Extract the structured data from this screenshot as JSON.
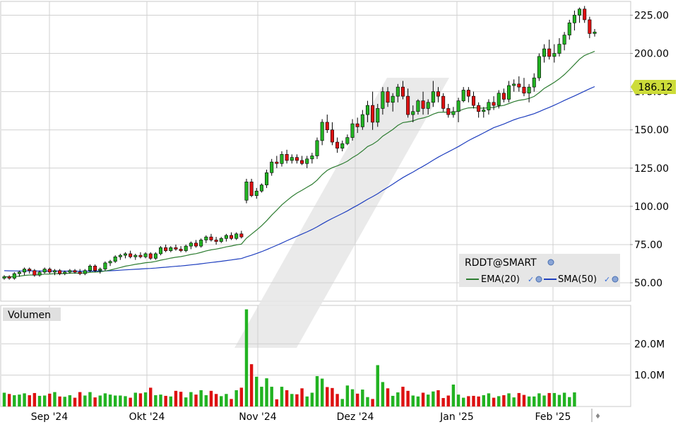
{
  "chart_data": {
    "type": "candlestick",
    "symbol": "RDDT@SMART",
    "last_price": "186.12",
    "price_axis": {
      "ticks": [
        "225.00",
        "200.00",
        "175.00",
        "150.00",
        "125.00",
        "100.00",
        "75.00",
        "50.00"
      ],
      "ylim": [
        38,
        234
      ]
    },
    "volume_axis": {
      "title": "Volumen",
      "ticks": [
        "20.0M",
        "10.0M"
      ],
      "ylim": [
        0,
        30
      ]
    },
    "x_labels": [
      "Sep '24",
      "Okt '24",
      "Nov '24",
      "Dez '24",
      "Jan '25",
      "Feb '25"
    ],
    "legend": [
      {
        "name": "EMA(20)",
        "color": "#2e7d32"
      },
      {
        "name": "SMA(50)",
        "color": "#1f3fbf"
      }
    ],
    "ohlc": [
      [
        53,
        55,
        52,
        54
      ],
      [
        54,
        55,
        52,
        53
      ],
      [
        53,
        57,
        52,
        56
      ],
      [
        56,
        58,
        54,
        57
      ],
      [
        57,
        60,
        55,
        59
      ],
      [
        59,
        60,
        56,
        58
      ],
      [
        58,
        59,
        54,
        55
      ],
      [
        55,
        58,
        54,
        57
      ],
      [
        57,
        60,
        56,
        59
      ],
      [
        59,
        60,
        56,
        57
      ],
      [
        57,
        59,
        55,
        58
      ],
      [
        58,
        59,
        55,
        56
      ],
      [
        56,
        58,
        55,
        57
      ],
      [
        57,
        59,
        56,
        58
      ],
      [
        58,
        59,
        56,
        57
      ],
      [
        57,
        59,
        55,
        56
      ],
      [
        56,
        59,
        55,
        58
      ],
      [
        58,
        62,
        57,
        61
      ],
      [
        61,
        62,
        57,
        58
      ],
      [
        58,
        60,
        56,
        59
      ],
      [
        59,
        64,
        58,
        63
      ],
      [
        63,
        65,
        61,
        64
      ],
      [
        64,
        68,
        63,
        67
      ],
      [
        67,
        69,
        65,
        68
      ],
      [
        68,
        70,
        66,
        69
      ],
      [
        69,
        71,
        66,
        67
      ],
      [
        67,
        69,
        65,
        68
      ],
      [
        68,
        70,
        66,
        67
      ],
      [
        67,
        70,
        66,
        69
      ],
      [
        69,
        70,
        65,
        66
      ],
      [
        66,
        70,
        65,
        69
      ],
      [
        69,
        74,
        68,
        73
      ],
      [
        73,
        75,
        70,
        71
      ],
      [
        71,
        74,
        70,
        73
      ],
      [
        73,
        75,
        71,
        72
      ],
      [
        72,
        74,
        70,
        71
      ],
      [
        71,
        75,
        70,
        74
      ],
      [
        74,
        77,
        72,
        76
      ],
      [
        76,
        78,
        73,
        74
      ],
      [
        74,
        79,
        73,
        78
      ],
      [
        78,
        81,
        76,
        80
      ],
      [
        80,
        82,
        77,
        78
      ],
      [
        78,
        80,
        75,
        77
      ],
      [
        77,
        80,
        76,
        79
      ],
      [
        79,
        82,
        77,
        81
      ],
      [
        81,
        83,
        78,
        79
      ],
      [
        79,
        83,
        78,
        82
      ],
      [
        82,
        84,
        79,
        80
      ],
      [
        104,
        118,
        102,
        116
      ],
      [
        116,
        118,
        106,
        107
      ],
      [
        107,
        112,
        105,
        110
      ],
      [
        110,
        115,
        109,
        114
      ],
      [
        114,
        124,
        112,
        122
      ],
      [
        122,
        131,
        120,
        129
      ],
      [
        129,
        133,
        125,
        128
      ],
      [
        128,
        136,
        126,
        134
      ],
      [
        134,
        137,
        128,
        130
      ],
      [
        130,
        134,
        128,
        132
      ],
      [
        132,
        134,
        128,
        130
      ],
      [
        130,
        133,
        127,
        128
      ],
      [
        128,
        133,
        125,
        131
      ],
      [
        131,
        135,
        128,
        133
      ],
      [
        133,
        145,
        131,
        143
      ],
      [
        143,
        157,
        140,
        155
      ],
      [
        155,
        160,
        148,
        150
      ],
      [
        150,
        155,
        140,
        142
      ],
      [
        142,
        145,
        135,
        138
      ],
      [
        138,
        143,
        136,
        141
      ],
      [
        141,
        147,
        140,
        145
      ],
      [
        145,
        157,
        143,
        154
      ],
      [
        154,
        158,
        148,
        152
      ],
      [
        152,
        163,
        150,
        160
      ],
      [
        160,
        169,
        155,
        166
      ],
      [
        166,
        175,
        150,
        155
      ],
      [
        155,
        167,
        152,
        164
      ],
      [
        164,
        178,
        160,
        175
      ],
      [
        175,
        178,
        165,
        168
      ],
      [
        168,
        174,
        162,
        172
      ],
      [
        172,
        180,
        168,
        178
      ],
      [
        178,
        182,
        170,
        172
      ],
      [
        172,
        177,
        158,
        160
      ],
      [
        160,
        166,
        155,
        162
      ],
      [
        162,
        170,
        160,
        169
      ],
      [
        169,
        175,
        160,
        164
      ],
      [
        164,
        170,
        160,
        168
      ],
      [
        168,
        182,
        165,
        175
      ],
      [
        175,
        178,
        168,
        172
      ],
      [
        172,
        174,
        162,
        164
      ],
      [
        164,
        167,
        158,
        160
      ],
      [
        160,
        165,
        158,
        162
      ],
      [
        162,
        171,
        155,
        169
      ],
      [
        169,
        178,
        168,
        176
      ],
      [
        176,
        178,
        168,
        172
      ],
      [
        172,
        175,
        164,
        166
      ],
      [
        166,
        168,
        158,
        162
      ],
      [
        162,
        165,
        158,
        163
      ],
      [
        163,
        170,
        160,
        168
      ],
      [
        168,
        172,
        163,
        166
      ],
      [
        166,
        176,
        164,
        174
      ],
      [
        174,
        177,
        168,
        170
      ],
      [
        170,
        182,
        168,
        179
      ],
      [
        179,
        183,
        175,
        180
      ],
      [
        180,
        185,
        175,
        178
      ],
      [
        178,
        184,
        172,
        174
      ],
      [
        174,
        180,
        168,
        178
      ],
      [
        178,
        187,
        175,
        184
      ],
      [
        184,
        200,
        182,
        198
      ],
      [
        198,
        206,
        194,
        203
      ],
      [
        203,
        209,
        196,
        198
      ],
      [
        198,
        206,
        194,
        200
      ],
      [
        200,
        210,
        198,
        206
      ],
      [
        206,
        214,
        202,
        212
      ],
      [
        212,
        222,
        209,
        220
      ],
      [
        220,
        228,
        215,
        225
      ],
      [
        225,
        230,
        220,
        229
      ],
      [
        229,
        231,
        220,
        222
      ],
      [
        222,
        224,
        210,
        213
      ],
      [
        213,
        216,
        211,
        214
      ]
    ],
    "volume": [
      4.4,
      4.0,
      3.6,
      3.8,
      4.2,
      3.6,
      4.3,
      3.4,
      3.5,
      4.1,
      4.6,
      3.2,
      3.1,
      3.6,
      2.8,
      4.6,
      3.5,
      4.6,
      2.9,
      3.5,
      4.2,
      3.8,
      3.5,
      3.5,
      3.3,
      2.8,
      4.4,
      4.2,
      4.5,
      6.0,
      3.6,
      3.8,
      3.4,
      3.2,
      5.0,
      4.7,
      2.9,
      4.6,
      3.8,
      5.2,
      3.6,
      5.0,
      4.0,
      3.3,
      4.0,
      2.4,
      5.2,
      6.0,
      31.0,
      13.5,
      9.5,
      6.3,
      9.0,
      6.3,
      2.3,
      6.3,
      5.2,
      4.0,
      3.9,
      5.8,
      3.2,
      4.4,
      9.7,
      8.9,
      6.2,
      5.9,
      4.0,
      2.4,
      6.7,
      5.5,
      4.1,
      5.4,
      3.0,
      2.4,
      13.2,
      7.8,
      5.8,
      3.4,
      4.5,
      6.3,
      5.0,
      3.5,
      3.2,
      4.4,
      3.8,
      4.8,
      5.2,
      2.7,
      3.5,
      7.0,
      3.8,
      2.8,
      3.3,
      3.4,
      3.2,
      3.6,
      4.2,
      2.8,
      3.3,
      3.6,
      4.2,
      2.9,
      4.3,
      3.7,
      3.2,
      3.2,
      4.2,
      3.5,
      4.3,
      4.3,
      3.7,
      4.4,
      3.0,
      4.5
    ]
  }
}
